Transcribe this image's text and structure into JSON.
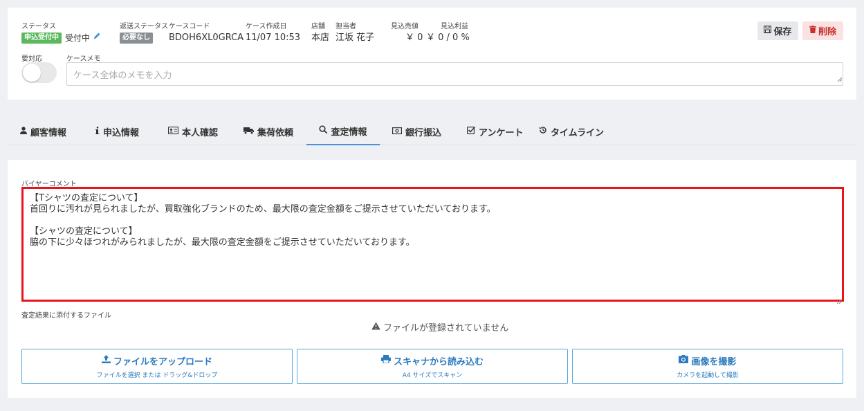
{
  "header": {
    "status": {
      "label": "ステータス",
      "badge": "申込受付中",
      "value": "受付中"
    },
    "return_status": {
      "label": "返送ステータス",
      "badge": "必要なし"
    },
    "case_code": {
      "label": "ケースコード",
      "value": "BDOH6XL0GRCA"
    },
    "created": {
      "label": "ケース作成日",
      "value": "11/07 10:53"
    },
    "store": {
      "label": "店舗",
      "value": "本店"
    },
    "assignee": {
      "label": "担当者",
      "value": "江坂 花子"
    },
    "est_price": {
      "label": "見込売値",
      "value": "￥ 0"
    },
    "est_profit": {
      "label": "見込利益",
      "value": "￥ 0 / 0 %"
    },
    "save_label": "保存",
    "delete_label": "削除",
    "attention_label": "要対応",
    "memo_label": "ケースメモ",
    "memo_placeholder": "ケース全体のメモを入力"
  },
  "tabs": [
    {
      "label": "顧客情報",
      "icon": "user-icon"
    },
    {
      "label": "申込情報",
      "icon": "info-icon"
    },
    {
      "label": "本人確認",
      "icon": "id-card-icon"
    },
    {
      "label": "集荷依頼",
      "icon": "truck-icon"
    },
    {
      "label": "査定情報",
      "icon": "search-icon",
      "active": true
    },
    {
      "label": "銀行振込",
      "icon": "money-icon"
    },
    {
      "label": "アンケート",
      "icon": "checkbox-icon"
    },
    {
      "label": "タイムライン",
      "icon": "history-icon"
    }
  ],
  "main": {
    "buyer_comment_label": "バイヤーコメント",
    "buyer_comment": "【Tシャツの査定について】\n首回りに汚れが見られましたが、買取強化ブランドのため、最大限の査定金額をご提示させていただいております。\n\n【シャツの査定について】\n脇の下に少々ほつれがみられましたが、最大限の査定金額をご提示させていただいております。",
    "attach_label": "査定結果に添付するファイル",
    "no_files": "ファイルが登録されていません",
    "actions": [
      {
        "title": "ファイルをアップロード",
        "sub": "ファイルを選択 または ドラッグ&ドロップ",
        "icon": "upload-icon"
      },
      {
        "title": "スキャナから読み込む",
        "sub": "A4 サイズでスキャン",
        "icon": "printer-icon"
      },
      {
        "title": "画像を撮影",
        "sub": "カメラを起動して撮影",
        "icon": "camera-icon"
      }
    ]
  },
  "colors": {
    "accent": "#4a90d9",
    "danger": "#c9302c",
    "highlight": "#e8141b",
    "success": "#5cb85c"
  }
}
